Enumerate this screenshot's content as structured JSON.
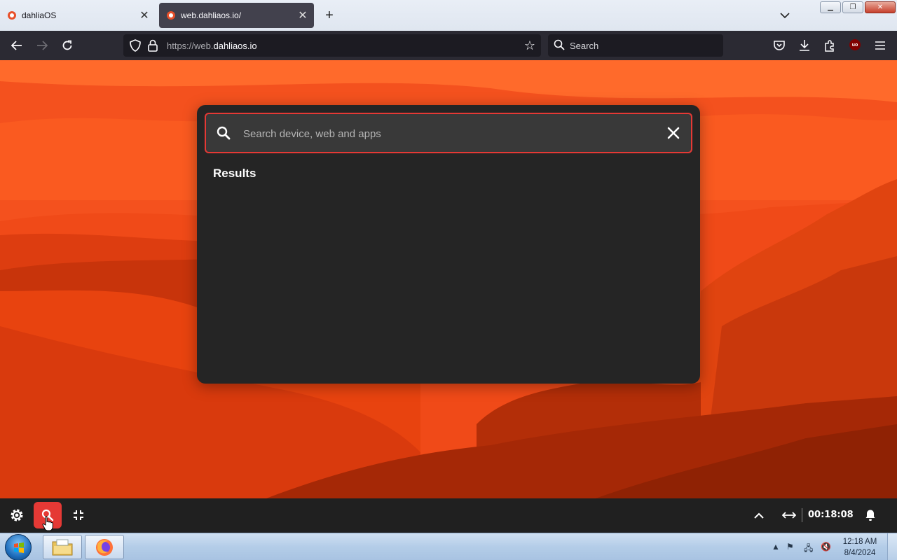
{
  "browser": {
    "tabs": [
      {
        "title": "dahliaOS",
        "active": false
      },
      {
        "title": "web.dahliaos.io/",
        "active": true
      }
    ],
    "url_prefix": "https://web.",
    "url_domain": "dahliaos.io",
    "search_placeholder": "Search",
    "extension_badge": "uo"
  },
  "launcher": {
    "search_placeholder": "Search device, web and apps",
    "results_title": "Results"
  },
  "shelf": {
    "clock": "00:18:08"
  },
  "taskbar": {
    "time": "12:18 AM",
    "date": "8/4/2024"
  },
  "colors": {
    "accent": "#e53935",
    "wallpaper_base": "#f4511e",
    "panel": "#252525"
  }
}
